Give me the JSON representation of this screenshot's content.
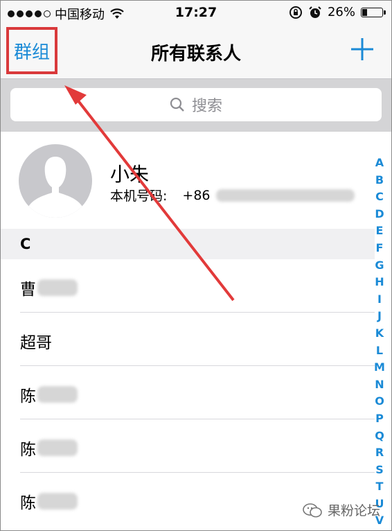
{
  "status_bar": {
    "carrier": "中国移动",
    "time": "17:27",
    "battery_percent": "26%",
    "battery_level": 0.26,
    "signal_bars_filled": 4,
    "signal_bars_total": 5
  },
  "nav": {
    "groups_label": "群组",
    "title": "所有联系人",
    "add_label": "+"
  },
  "search": {
    "placeholder": "搜索"
  },
  "my_card": {
    "name": "小朱",
    "number_label": "本机号码:",
    "number_prefix": "+86"
  },
  "sections": [
    {
      "letter": "C",
      "contacts": [
        {
          "name": "曹"
        },
        {
          "name": "超哥"
        },
        {
          "name": "陈"
        },
        {
          "name": "陈"
        },
        {
          "name": "陈"
        }
      ]
    }
  ],
  "index_letters": [
    "A",
    "B",
    "C",
    "D",
    "E",
    "F",
    "G",
    "H",
    "I",
    "J",
    "K",
    "L",
    "M",
    "N",
    "O",
    "P",
    "Q",
    "R",
    "S",
    "T",
    "U",
    "V"
  ],
  "watermark": {
    "text": "果粉论坛"
  },
  "colors": {
    "accent": "#1a8ad6",
    "highlight": "#d9393b"
  }
}
